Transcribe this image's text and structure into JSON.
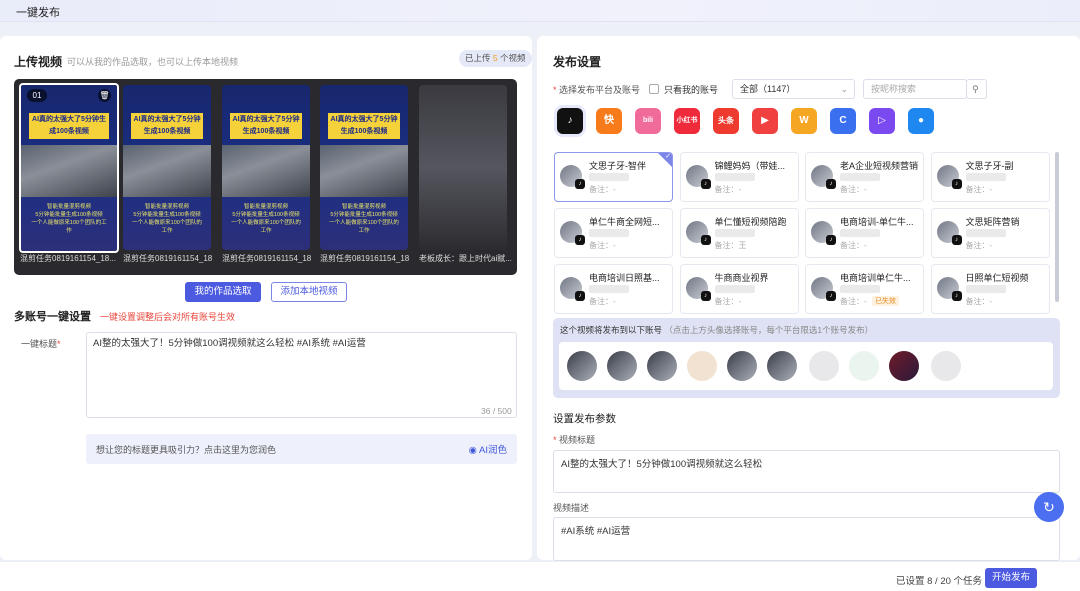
{
  "topbar": {
    "title": "一键发布"
  },
  "upload": {
    "title": "上传视频",
    "hint": "可以从我的作品选取，也可以上传本地视频",
    "badge_prefix": "已上传",
    "badge_count": "5",
    "badge_suffix": "个视频",
    "thumbs": [
      {
        "num": "01",
        "caption": "AI真的太强大了5分钟生成100条视频",
        "sub": "智能批量混剪视频\n5分钟能批量生成100条视频\n一个人能做原来100个团队的工作",
        "label": "混剪任务0819161154_18..."
      },
      {
        "caption": "AI真的太强大了5分钟生成100条视频",
        "sub": "智能批量混剪视频\n5分钟能批量生成100条视频\n一个人能做原来100个团队的工作",
        "label": "混剪任务0819161154_18..."
      },
      {
        "caption": "AI真的太强大了5分钟生成100条视频",
        "sub": "智能批量混剪视频\n5分钟能批量生成100条视频\n一个人能做原来100个团队的工作",
        "label": "混剪任务0819161154_18..."
      },
      {
        "caption": "AI真的太强大了5分钟生成100条视频",
        "sub": "智能批量混剪视频\n5分钟能批量生成100条视频\n一个人能做原来100个团队的工作",
        "label": "混剪任务0819161154_18..."
      },
      {
        "label": "老板成长：跟上时代ai赋..."
      }
    ],
    "btn_my_works": "我的作品选取",
    "btn_add_local": "添加本地视频"
  },
  "multi": {
    "title": "多账号一键设置",
    "warn": "一键设置调整后会对所有账号生效",
    "label": "一键标题",
    "value": "AI整的太强大了！5分钟做100调视频就这么轻松 #AI系统 #AI运营",
    "counter": "36 / 500",
    "ai_hint": "想让您的标题更具吸引力？点击这里为您润色",
    "ai_btn": "AI润色"
  },
  "publish": {
    "title": "发布设置",
    "platform_label": "选择发布平台及账号",
    "only_mine": "只看我的账号",
    "select_value": "全部（1147）",
    "search_placeholder": "按昵称搜索",
    "platforms": [
      {
        "name": "douyin-icon",
        "text": "♪",
        "color": "#111111"
      },
      {
        "name": "kuaishou-icon",
        "text": "快",
        "color": "#f87b1b"
      },
      {
        "name": "bilibili-icon",
        "text": "bili",
        "color": "#f06b9a"
      },
      {
        "name": "xiaohongshu-icon",
        "text": "小红书",
        "color": "#ef2a3a"
      },
      {
        "name": "toutiao-icon",
        "text": "头条",
        "color": "#ef3a2f"
      },
      {
        "name": "xigua-icon",
        "text": "▶",
        "color": "#f04040"
      },
      {
        "name": "weishi-icon",
        "text": "W",
        "color": "#f5a623"
      },
      {
        "name": "haokan-icon",
        "text": "C",
        "color": "#3a6ff0"
      },
      {
        "name": "baijiahao-icon",
        "text": "▷",
        "color": "#7a4af0"
      },
      {
        "name": "tencent-video-icon",
        "text": "●",
        "color": "#1e88f0"
      }
    ],
    "accounts": [
      {
        "name": "文思子牙-智伴",
        "remark": "备注：-",
        "selected": true
      },
      {
        "name": "锦鲤妈妈（带娃...",
        "remark": "备注：-"
      },
      {
        "name": "老A企业短视频营销",
        "remark": "备注：-"
      },
      {
        "name": "文思子牙-副",
        "remark": "备注：-"
      },
      {
        "name": "单仁牛商全网短...",
        "remark": "备注：-"
      },
      {
        "name": "单仁懂短视频陪跑",
        "remark": "备注：王"
      },
      {
        "name": "电商培训-单仁牛...",
        "remark": "备注：-"
      },
      {
        "name": "文思矩阵营销",
        "remark": "备注：-"
      },
      {
        "name": "电商培训日照基...",
        "remark": "备注：-"
      },
      {
        "name": "牛商商业视界",
        "remark": "备注：-"
      },
      {
        "name": "电商培训单仁牛...",
        "remark": "备注：-",
        "tag": "已失效"
      },
      {
        "name": "日照单仁短视频",
        "remark": "备注：-"
      }
    ],
    "selected_head": "这个视频将发布到以下账号",
    "selected_hint": "（点击上方头像选择账号，每个平台限选1个账号发布）",
    "params_title": "设置发布参数",
    "video_title_label": "视频标题",
    "video_title_value": "AI整的太强大了！5分钟做100调视频就这么轻松",
    "video_desc_label": "视频描述",
    "video_desc_value": "#AI系统 #AI运营"
  },
  "footer": {
    "status": "已设置 8 / 20 个任务",
    "start": "开始发布"
  }
}
